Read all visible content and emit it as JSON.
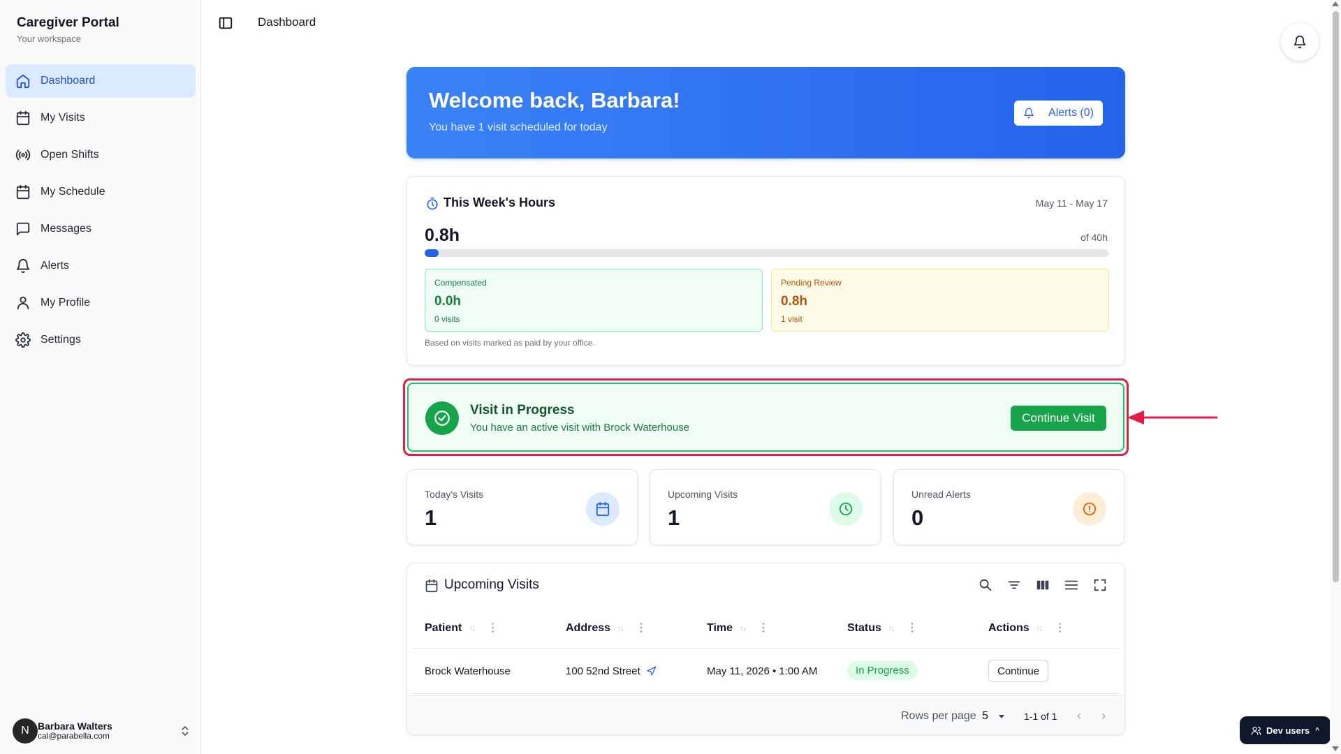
{
  "sidebar": {
    "brand_title": "Caregiver Portal",
    "brand_subtitle": "Your workspace",
    "items": [
      {
        "label": "Dashboard",
        "icon": "home-icon",
        "active": true
      },
      {
        "label": "My Visits",
        "icon": "calendar-icon"
      },
      {
        "label": "Open Shifts",
        "icon": "broadcast-icon"
      },
      {
        "label": "My Schedule",
        "icon": "calendar-icon"
      },
      {
        "label": "Messages",
        "icon": "message-icon"
      },
      {
        "label": "Alerts",
        "icon": "bell-icon"
      },
      {
        "label": "My Profile",
        "icon": "user-icon"
      },
      {
        "label": "Settings",
        "icon": "gear-icon"
      }
    ],
    "user": {
      "initial": "N",
      "name": "Barbara Walters",
      "email": "cal@parabella.com"
    }
  },
  "header": {
    "breadcrumb": "Dashboard"
  },
  "hero": {
    "title": "Welcome back, Barbara!",
    "subtitle": "You have 1 visit scheduled for today",
    "alerts_button": "Alerts (0)"
  },
  "hours": {
    "title": "This Week's Hours",
    "range": "May 11 - May 17",
    "value": "0.8h",
    "of_total": "of 40h",
    "progress_fraction": 0.02,
    "compensated": {
      "label": "Compensated",
      "value": "0.0h",
      "count": "0 visits"
    },
    "pending": {
      "label": "Pending Review",
      "value": "0.8h",
      "count": "1 visit"
    },
    "note": "Based on visits marked as paid by your office."
  },
  "visit_in_progress": {
    "title": "Visit in Progress",
    "subtitle": "You have an active visit with Brock Waterhouse",
    "button": "Continue Visit"
  },
  "stats": [
    {
      "label": "Today's Visits",
      "value": "1",
      "icon": "calendar-icon",
      "color": "#2563eb",
      "bg": "#dbeafe"
    },
    {
      "label": "Upcoming Visits",
      "value": "1",
      "icon": "clock-icon",
      "color": "#16a34a",
      "bg": "#dcfce7"
    },
    {
      "label": "Unread Alerts",
      "value": "0",
      "icon": "alert-circle-icon",
      "color": "#ea580c",
      "bg": "#ffedd5"
    }
  ],
  "upcoming": {
    "title": "Upcoming Visits",
    "columns": [
      "Patient",
      "Address",
      "Time",
      "Status",
      "Actions"
    ],
    "rows": [
      {
        "patient": "Brock Waterhouse",
        "address": "100 52nd Street",
        "time": "May 11, 2026 • 1:00 AM",
        "status": "In Progress",
        "action": "Continue"
      }
    ],
    "footer": {
      "rows_per_page_label": "Rows per page",
      "rows_per_page": "5",
      "range": "1-1 of 1"
    }
  },
  "dev_users": "Dev users",
  "colors": {
    "primary": "#2563eb",
    "success": "#16a34a",
    "highlight": "#e11d48"
  }
}
